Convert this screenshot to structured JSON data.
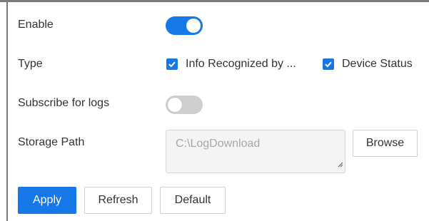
{
  "enable": {
    "label": "Enable",
    "value": true
  },
  "type": {
    "label": "Type",
    "options": [
      {
        "label": "Info Recognized by ...",
        "checked": true
      },
      {
        "label": "Device Status",
        "checked": true
      }
    ]
  },
  "subscribe_logs": {
    "label": "Subscribe for logs",
    "value": false
  },
  "storage_path": {
    "label": "Storage Path",
    "value": "C:\\LogDownload",
    "browse_label": "Browse"
  },
  "actions": {
    "apply_label": "Apply",
    "refresh_label": "Refresh",
    "default_label": "Default"
  },
  "colors": {
    "accent": "#1677e6",
    "toggle_off": "#cfcfcf",
    "field_bg": "#f4f4f4"
  }
}
